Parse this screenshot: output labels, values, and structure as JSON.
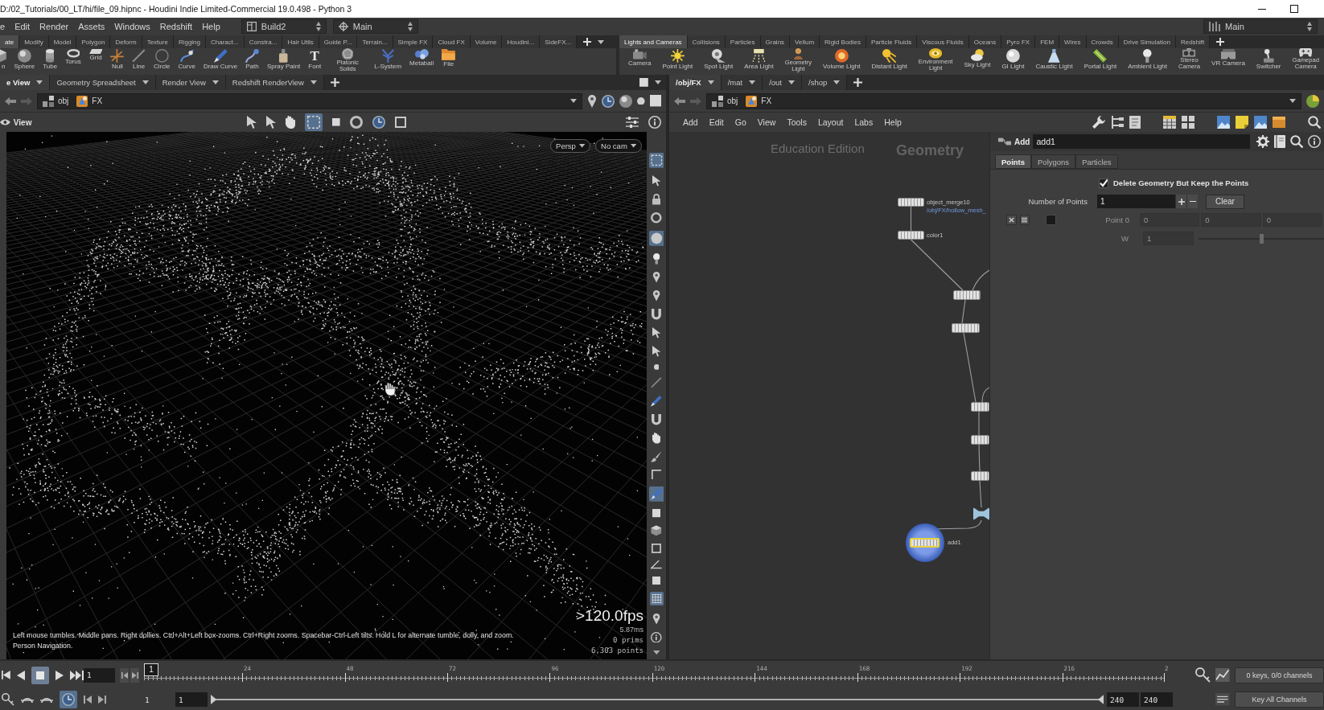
{
  "window": {
    "title": "D:/02_Tutorials/00_LT/hi/file_09.hipnc - Houdini Indie Limited-Commercial 19.0.498 - Python 3"
  },
  "menu_bar": {
    "items": [
      "e",
      "Edit",
      "Render",
      "Assets",
      "Windows",
      "Redshift",
      "Help"
    ],
    "desktops": [
      "Build2",
      "Main"
    ],
    "right_desktop": "Main"
  },
  "shelf_left": {
    "tabs": [
      {
        "label": "ate",
        "selected": true
      },
      {
        "label": "Modify",
        "selected": false
      },
      {
        "label": "Model",
        "selected": false
      },
      {
        "label": "Polygon",
        "selected": false
      },
      {
        "label": "Deform",
        "selected": false
      },
      {
        "label": "Texture",
        "selected": false
      },
      {
        "label": "Rigging",
        "selected": false
      },
      {
        "label": "Charact...",
        "selected": false
      },
      {
        "label": "Constra...",
        "selected": false
      },
      {
        "label": "Hair Utils",
        "selected": false
      },
      {
        "label": "Guide P...",
        "selected": false
      },
      {
        "label": "Terrain...",
        "selected": false
      },
      {
        "label": "Simple FX",
        "selected": false
      },
      {
        "label": "Cloud FX",
        "selected": false
      },
      {
        "label": "Volume",
        "selected": false
      },
      {
        "label": "Houdini...",
        "selected": false
      },
      {
        "label": "SideFX...",
        "selected": false
      }
    ],
    "tools": [
      {
        "label": "n"
      },
      {
        "label": "Sphere"
      },
      {
        "label": "Tube"
      },
      {
        "label": "Torus"
      },
      {
        "label": "Grid"
      },
      {
        "label": "Null"
      },
      {
        "label": "Line"
      },
      {
        "label": "Circle"
      },
      {
        "label": "Curve"
      },
      {
        "label": "Draw Curve"
      },
      {
        "label": "Path"
      },
      {
        "label": "Spray Paint"
      },
      {
        "label": "Font",
        "glyph": "T"
      },
      {
        "label": "Platonic Solids"
      },
      {
        "label": "L-System"
      },
      {
        "label": "Metaball"
      },
      {
        "label": "File"
      }
    ]
  },
  "shelf_right": {
    "tabs": [
      {
        "label": "Lights and Cameras",
        "selected": true
      },
      {
        "label": "Collisions",
        "selected": false
      },
      {
        "label": "Particles",
        "selected": false
      },
      {
        "label": "Grains",
        "selected": false
      },
      {
        "label": "Vellum",
        "selected": false
      },
      {
        "label": "Rigid Bodies",
        "selected": false
      },
      {
        "label": "Particle Fluids",
        "selected": false
      },
      {
        "label": "Viscous Fluids",
        "selected": false
      },
      {
        "label": "Oceans",
        "selected": false
      },
      {
        "label": "Pyro FX",
        "selected": false
      },
      {
        "label": "FEM",
        "selected": false
      },
      {
        "label": "Wires",
        "selected": false
      },
      {
        "label": "Crowds",
        "selected": false
      },
      {
        "label": "Drive Simulation",
        "selected": false
      },
      {
        "label": "Redshift",
        "selected": false
      }
    ],
    "tools": [
      {
        "label": "Camera"
      },
      {
        "label": "Point Light"
      },
      {
        "label": "Spot Light"
      },
      {
        "label": "Area Light"
      },
      {
        "label": "Geometry Light"
      },
      {
        "label": "Volume Light"
      },
      {
        "label": "Distant Light"
      },
      {
        "label": "Environment Light"
      },
      {
        "label": "Sky Light"
      },
      {
        "label": "GI Light"
      },
      {
        "label": "Caustic Light"
      },
      {
        "label": "Portal Light"
      },
      {
        "label": "Ambient Light"
      },
      {
        "label": "Stereo Camera"
      },
      {
        "label": "VR Camera"
      },
      {
        "label": "Switcher"
      },
      {
        "label": "Gamepad Camera"
      }
    ]
  },
  "scene_view": {
    "tabs": [
      {
        "label": "e View",
        "selected": true
      },
      {
        "label": "Geometry Spreadsheet",
        "selected": false
      },
      {
        "label": "Render View",
        "selected": false
      },
      {
        "label": "Redshift RenderView",
        "selected": false
      }
    ],
    "path": [
      "obj",
      "FX"
    ],
    "toolbar_label": "View",
    "camera_menus": [
      "Persp",
      "No cam"
    ],
    "help_lines": [
      "Left mouse tumbles. Middle pans. Right dollies. Ctrl+Alt+Left box-zooms. Ctrl+Right zooms. Spacebar-Ctrl-Left tilts. Hold L for alternate tumble, dolly, and zoom.",
      "Person Navigation."
    ],
    "stats": [
      ">120.0fps",
      "5.87ms",
      "0 prims",
      "6,303 points"
    ]
  },
  "network": {
    "tabs": [
      {
        "label": "/obj/FX",
        "selected": true
      },
      {
        "label": "/mat",
        "selected": false
      },
      {
        "label": "/out",
        "selected": false
      },
      {
        "label": "/shop",
        "selected": false
      }
    ],
    "path": [
      "obj",
      "FX"
    ],
    "menu": [
      "Add",
      "Edit",
      "Go",
      "View",
      "Tools",
      "Layout",
      "Labs",
      "Help"
    ],
    "watermark": "Education Edition",
    "context_label": "Geometry",
    "nodes": [
      {
        "kind": "tile",
        "label": "object_merge10",
        "sublabel": "/obj/FX/hollow_mesh_",
        "selected": false
      },
      {
        "kind": "tile",
        "label": "color1",
        "selected": false
      },
      {
        "kind": "tile",
        "selected": false
      },
      {
        "kind": "tile",
        "selected": false
      },
      {
        "kind": "tile",
        "selected": false
      },
      {
        "kind": "tile",
        "selected": false
      },
      {
        "kind": "tile",
        "selected": false
      },
      {
        "kind": "cross",
        "selected": false
      },
      {
        "kind": "tile",
        "label": "add1",
        "selected": true
      }
    ]
  },
  "parameters": {
    "node_type": "Add",
    "node_name": "add1",
    "tabs": [
      {
        "label": "Points",
        "selected": true
      },
      {
        "label": "Polygons",
        "selected": false
      },
      {
        "label": "Particles",
        "selected": false
      }
    ],
    "delete_geometry": {
      "label": "Delete Geometry But Keep the Points",
      "checked": true
    },
    "number_of_points": {
      "label": "Number of Points",
      "value": "1"
    },
    "clear_button": "Clear",
    "point": {
      "enabled": false,
      "label": "Point 0",
      "values": [
        "0",
        "0",
        "0"
      ],
      "weight_label": "W",
      "weight_value": "1",
      "level": 0.5
    }
  },
  "timeline": {
    "frame": "1",
    "marker": "1",
    "ticks": [
      "24",
      "48",
      "72",
      "96",
      "120",
      "144",
      "168",
      "192",
      "216",
      "2"
    ],
    "range": [
      "1",
      "1",
      "240",
      "240"
    ],
    "range_slider": {
      "level": 1
    },
    "keys_status": "0 keys, 0/0 channels",
    "key_all": "Key All Channels"
  }
}
